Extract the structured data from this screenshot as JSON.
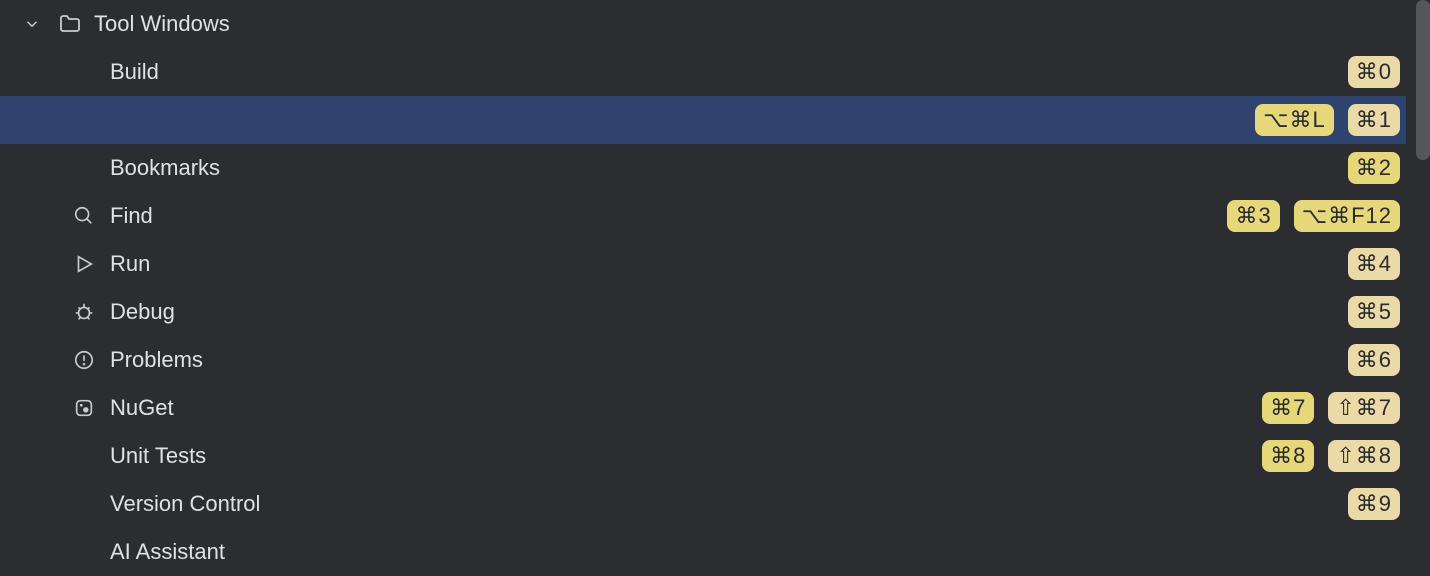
{
  "group": {
    "label": "Tool Windows"
  },
  "items": [
    {
      "label": "Build",
      "icon": "",
      "selected": false,
      "shortcuts": [
        {
          "text": "⌘0",
          "style": "light"
        }
      ]
    },
    {
      "label": "",
      "icon": "",
      "selected": true,
      "shortcuts": [
        {
          "text": "⌥⌘L",
          "style": ""
        },
        {
          "text": "⌘1",
          "style": "light"
        }
      ]
    },
    {
      "label": "Bookmarks",
      "icon": "",
      "selected": false,
      "shortcuts": [
        {
          "text": "⌘2",
          "style": ""
        }
      ]
    },
    {
      "label": "Find",
      "icon": "search",
      "selected": false,
      "shortcuts": [
        {
          "text": "⌘3",
          "style": ""
        },
        {
          "text": "⌥⌘F12",
          "style": ""
        }
      ]
    },
    {
      "label": "Run",
      "icon": "play",
      "selected": false,
      "shortcuts": [
        {
          "text": "⌘4",
          "style": "light"
        }
      ]
    },
    {
      "label": "Debug",
      "icon": "bug",
      "selected": false,
      "shortcuts": [
        {
          "text": "⌘5",
          "style": "light"
        }
      ]
    },
    {
      "label": "Problems",
      "icon": "warning",
      "selected": false,
      "shortcuts": [
        {
          "text": "⌘6",
          "style": "light"
        }
      ]
    },
    {
      "label": "NuGet",
      "icon": "nuget",
      "selected": false,
      "shortcuts": [
        {
          "text": "⌘7",
          "style": ""
        },
        {
          "text": "⇧⌘7",
          "style": "light"
        }
      ]
    },
    {
      "label": "Unit Tests",
      "icon": "",
      "selected": false,
      "shortcuts": [
        {
          "text": "⌘8",
          "style": ""
        },
        {
          "text": "⇧⌘8",
          "style": "light"
        }
      ]
    },
    {
      "label": "Version Control",
      "icon": "",
      "selected": false,
      "shortcuts": [
        {
          "text": "⌘9",
          "style": "light"
        }
      ]
    },
    {
      "label": "AI Assistant",
      "icon": "",
      "selected": false,
      "shortcuts": []
    }
  ]
}
